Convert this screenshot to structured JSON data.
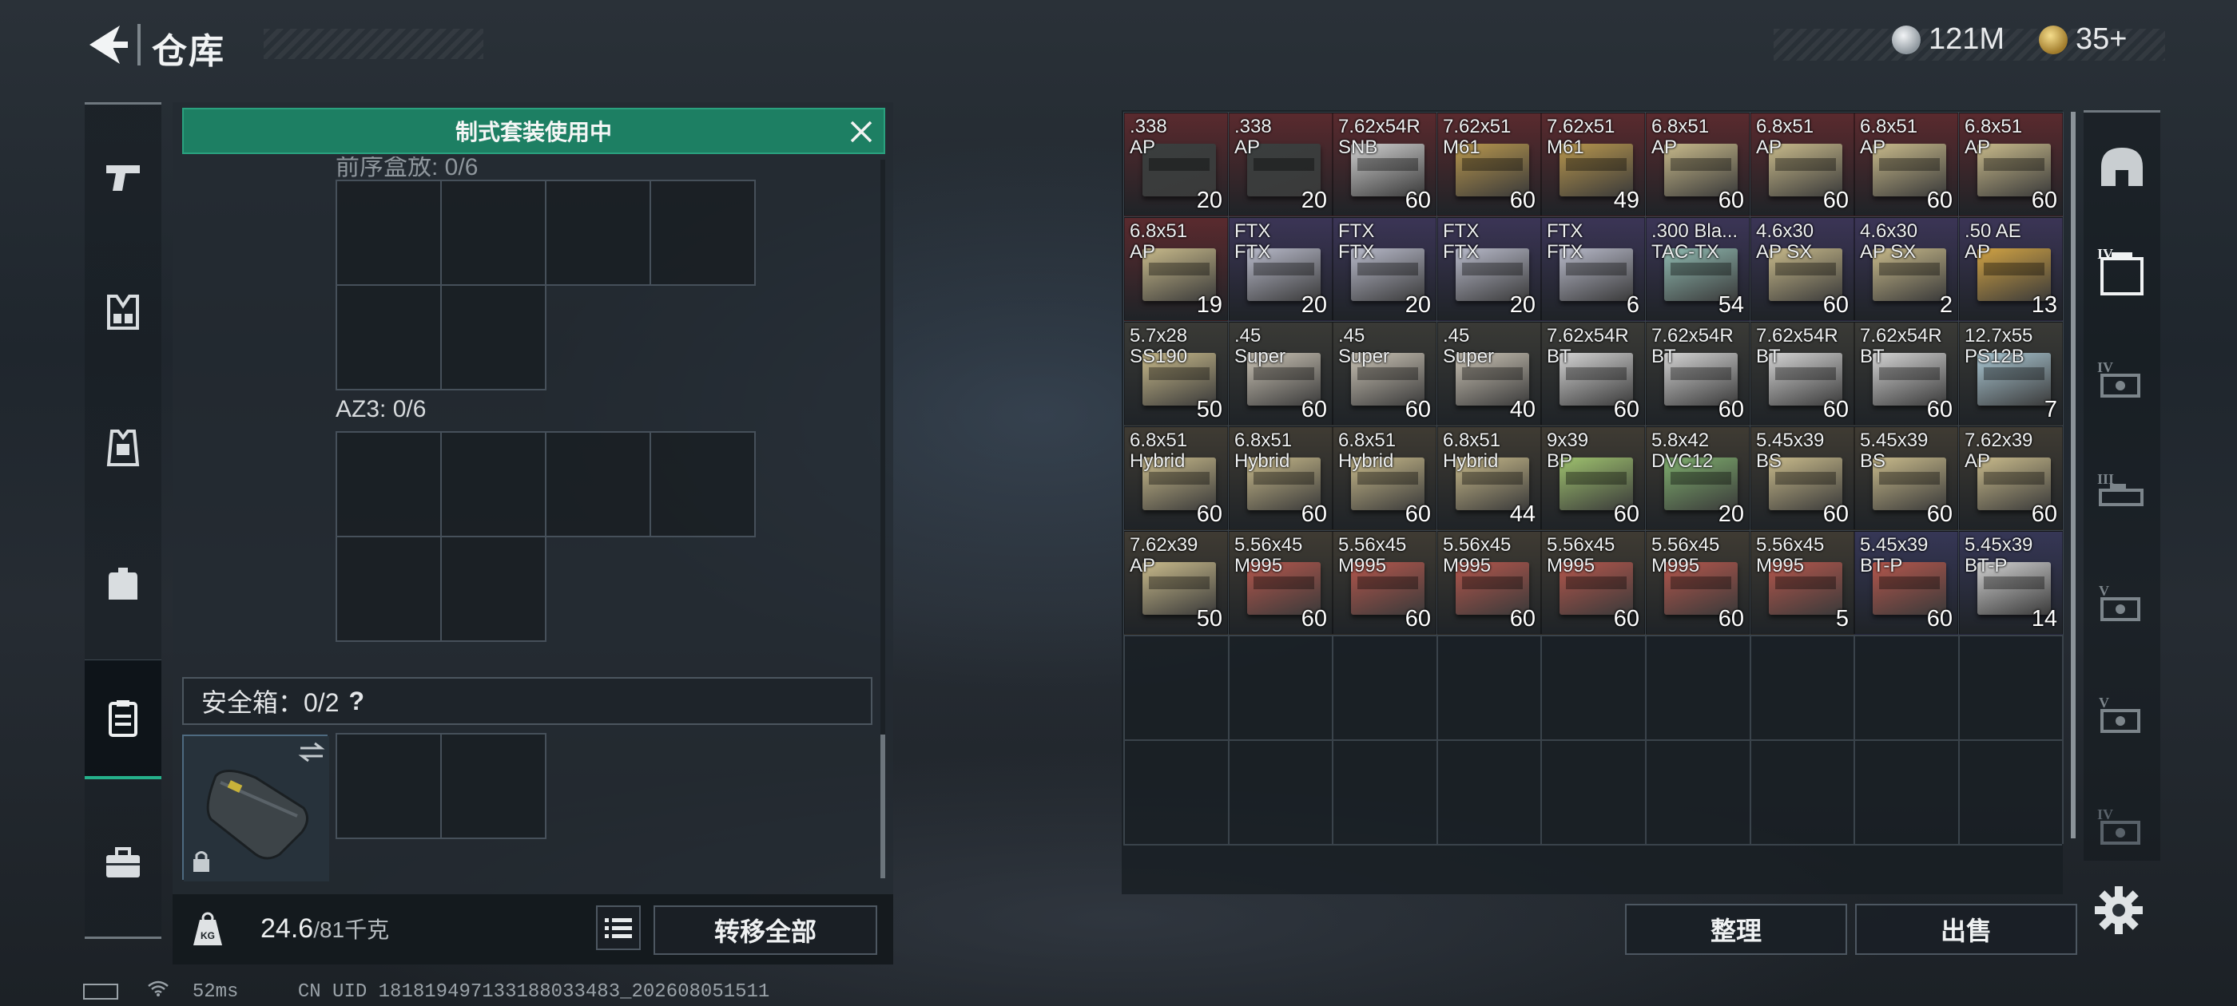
{
  "header": {
    "title": "仓库",
    "currencies": [
      {
        "icon": "silver-coin-icon",
        "value": "121M",
        "color": "#b9c2c8"
      },
      {
        "icon": "gold-coin-icon",
        "value": "35+",
        "color": "#c9a24a"
      }
    ]
  },
  "left_nav": [
    {
      "icon": "pistol-icon"
    },
    {
      "icon": "chest-rig-icon"
    },
    {
      "icon": "armor-vest-icon"
    },
    {
      "icon": "backpack-icon"
    },
    {
      "icon": "storage-case-icon",
      "active": true
    },
    {
      "icon": "toolbox-icon"
    }
  ],
  "loadout_panel": {
    "banner": "制式套装使用中",
    "partial_section_label": "前序盒放: 0/6",
    "az3_label": "AZ3: 0/6",
    "safe_box_label": "安全箱：0/2",
    "safe_box_help": "?",
    "weight_value": "24.6",
    "weight_max": "/81千克",
    "weight_icon_text": "KG",
    "transfer_all_label": "转移全部"
  },
  "warehouse": {
    "items": [
      {
        "name": ".338\nAP",
        "qty": "20",
        "bg": "#5a2a2e",
        "box": "#3a3e3e"
      },
      {
        "name": ".338\nAP",
        "qty": "20",
        "bg": "#5a2a2e",
        "box": "#3a3e3e"
      },
      {
        "name": "7.62x54R\nSNB",
        "qty": "60",
        "bg": "#5a2a2e",
        "box": "#cfcfcf"
      },
      {
        "name": "7.62x51\nM61",
        "qty": "60",
        "bg": "#5a2a2e",
        "box": "#b7964d"
      },
      {
        "name": "7.62x51\nM61",
        "qty": "49",
        "bg": "#5a2a2e",
        "box": "#b7964d"
      },
      {
        "name": "6.8x51\nAP",
        "qty": "60",
        "bg": "#5a2a2e",
        "box": "#c7b98a"
      },
      {
        "name": "6.8x51\nAP",
        "qty": "60",
        "bg": "#5a2a2e",
        "box": "#c7b98a"
      },
      {
        "name": "6.8x51\nAP",
        "qty": "60",
        "bg": "#5a2a2e",
        "box": "#c7b98a"
      },
      {
        "name": "6.8x51\nAP",
        "qty": "60",
        "bg": "#5a2a2e",
        "box": "#c7b98a"
      },
      {
        "name": "6.8x51\nAP",
        "qty": "19",
        "bg": "#5a2a2e",
        "box": "#c7b98a"
      },
      {
        "name": "FTX\nFTX",
        "qty": "20",
        "bg": "#3b3556",
        "box": "#b7b9c9"
      },
      {
        "name": "FTX\nFTX",
        "qty": "20",
        "bg": "#3b3556",
        "box": "#b7b9c9"
      },
      {
        "name": "FTX\nFTX",
        "qty": "20",
        "bg": "#3b3556",
        "box": "#b7b9c9"
      },
      {
        "name": "FTX\nFTX",
        "qty": "6",
        "bg": "#3b3556",
        "box": "#b7b9c9"
      },
      {
        "name": ".300 Bla...\nTAC-TX",
        "qty": "54",
        "bg": "#3b3556",
        "box": "#8fb9b0"
      },
      {
        "name": "4.6x30\nAP SX",
        "qty": "60",
        "bg": "#3b3556",
        "box": "#c7b98a"
      },
      {
        "name": "4.6x30\nAP SX",
        "qty": "2",
        "bg": "#3b3556",
        "box": "#c7b98a"
      },
      {
        "name": ".50 AE\nAP",
        "qty": "13",
        "bg": "#3b3556",
        "box": "#d0a243"
      },
      {
        "name": "5.7x28\nSS190",
        "qty": "50",
        "bg": "#3a3a36",
        "box": "#c7b98a"
      },
      {
        "name": ".45\nSuper",
        "qty": "60",
        "bg": "#3a3a36",
        "box": "#c9c2b4"
      },
      {
        "name": ".45\nSuper",
        "qty": "60",
        "bg": "#3a3a36",
        "box": "#c9c2b4"
      },
      {
        "name": ".45\nSuper",
        "qty": "40",
        "bg": "#3a3a36",
        "box": "#c9c2b4"
      },
      {
        "name": "7.62x54R\nBT",
        "qty": "60",
        "bg": "#3a3a36",
        "box": "#d2d2d2"
      },
      {
        "name": "7.62x54R\nBT",
        "qty": "60",
        "bg": "#3a3a36",
        "box": "#d2d2d2"
      },
      {
        "name": "7.62x54R\nBT",
        "qty": "60",
        "bg": "#3a3a36",
        "box": "#d2d2d2"
      },
      {
        "name": "7.62x54R\nBT",
        "qty": "60",
        "bg": "#3a3a36",
        "box": "#d2d2d2"
      },
      {
        "name": "12.7x55\nPS12B",
        "qty": "7",
        "bg": "#3a3a36",
        "box": "#a9c6d2"
      },
      {
        "name": "6.8x51\nHybrid",
        "qty": "60",
        "bg": "#3f3b33",
        "box": "#c7b98a"
      },
      {
        "name": "6.8x51\nHybrid",
        "qty": "60",
        "bg": "#3f3b33",
        "box": "#c7b98a"
      },
      {
        "name": "6.8x51\nHybrid",
        "qty": "60",
        "bg": "#3f3b33",
        "box": "#c7b98a"
      },
      {
        "name": "6.8x51\nHybrid",
        "qty": "44",
        "bg": "#3f3b33",
        "box": "#c7b98a"
      },
      {
        "name": "9x39\nBP",
        "qty": "60",
        "bg": "#3f3b33",
        "box": "#9ec16e"
      },
      {
        "name": "5.8x42\nDVC12",
        "qty": "20",
        "bg": "#3f3b33",
        "box": "#7fae6e"
      },
      {
        "name": "5.45x39\nBS",
        "qty": "60",
        "bg": "#3f3b33",
        "box": "#c7b98a"
      },
      {
        "name": "5.45x39\nBS",
        "qty": "60",
        "bg": "#3f3b33",
        "box": "#c7b98a"
      },
      {
        "name": "7.62x39\nAP",
        "qty": "60",
        "bg": "#3f3b33",
        "box": "#c7b98a"
      },
      {
        "name": "7.62x39\nAP",
        "qty": "50",
        "bg": "#3f3b33",
        "box": "#c7b98a"
      },
      {
        "name": "5.56x45\nM995",
        "qty": "60",
        "bg": "#3f3b33",
        "box": "#b3564c"
      },
      {
        "name": "5.56x45\nM995",
        "qty": "60",
        "bg": "#3f3b33",
        "box": "#b3564c"
      },
      {
        "name": "5.56x45\nM995",
        "qty": "60",
        "bg": "#3f3b33",
        "box": "#b3564c"
      },
      {
        "name": "5.56x45\nM995",
        "qty": "60",
        "bg": "#3f3b33",
        "box": "#b3564c"
      },
      {
        "name": "5.56x45\nM995",
        "qty": "60",
        "bg": "#3f3b33",
        "box": "#b3564c"
      },
      {
        "name": "5.56x45\nM995",
        "qty": "5",
        "bg": "#3f3b33",
        "box": "#b3564c"
      },
      {
        "name": "5.45x39\nBT-P",
        "qty": "60",
        "bg": "#363756",
        "box": "#b3564c"
      },
      {
        "name": "5.45x39\nBT-P",
        "qty": "14",
        "bg": "#363756",
        "box": "#d0d0d0"
      }
    ],
    "sort_label": "整理",
    "sell_label": "出售"
  },
  "right_categories": [
    {
      "icon": "helmet-icon",
      "tier": ""
    },
    {
      "icon": "case-tier4-icon",
      "tier": "IV"
    },
    {
      "icon": "rifle-tier4-icon",
      "tier": "IV"
    },
    {
      "icon": "rifle-tier3-icon",
      "tier": "III"
    },
    {
      "icon": "rifle-tier5-icon",
      "tier": "V"
    },
    {
      "icon": "rifle-tier5-icon",
      "tier": "V"
    },
    {
      "icon": "rifle-tier4-icon",
      "tier": "IV"
    }
  ],
  "status": {
    "ping": "52ms",
    "uid": "CN UID 18181949713318803348​3_202608051511"
  }
}
